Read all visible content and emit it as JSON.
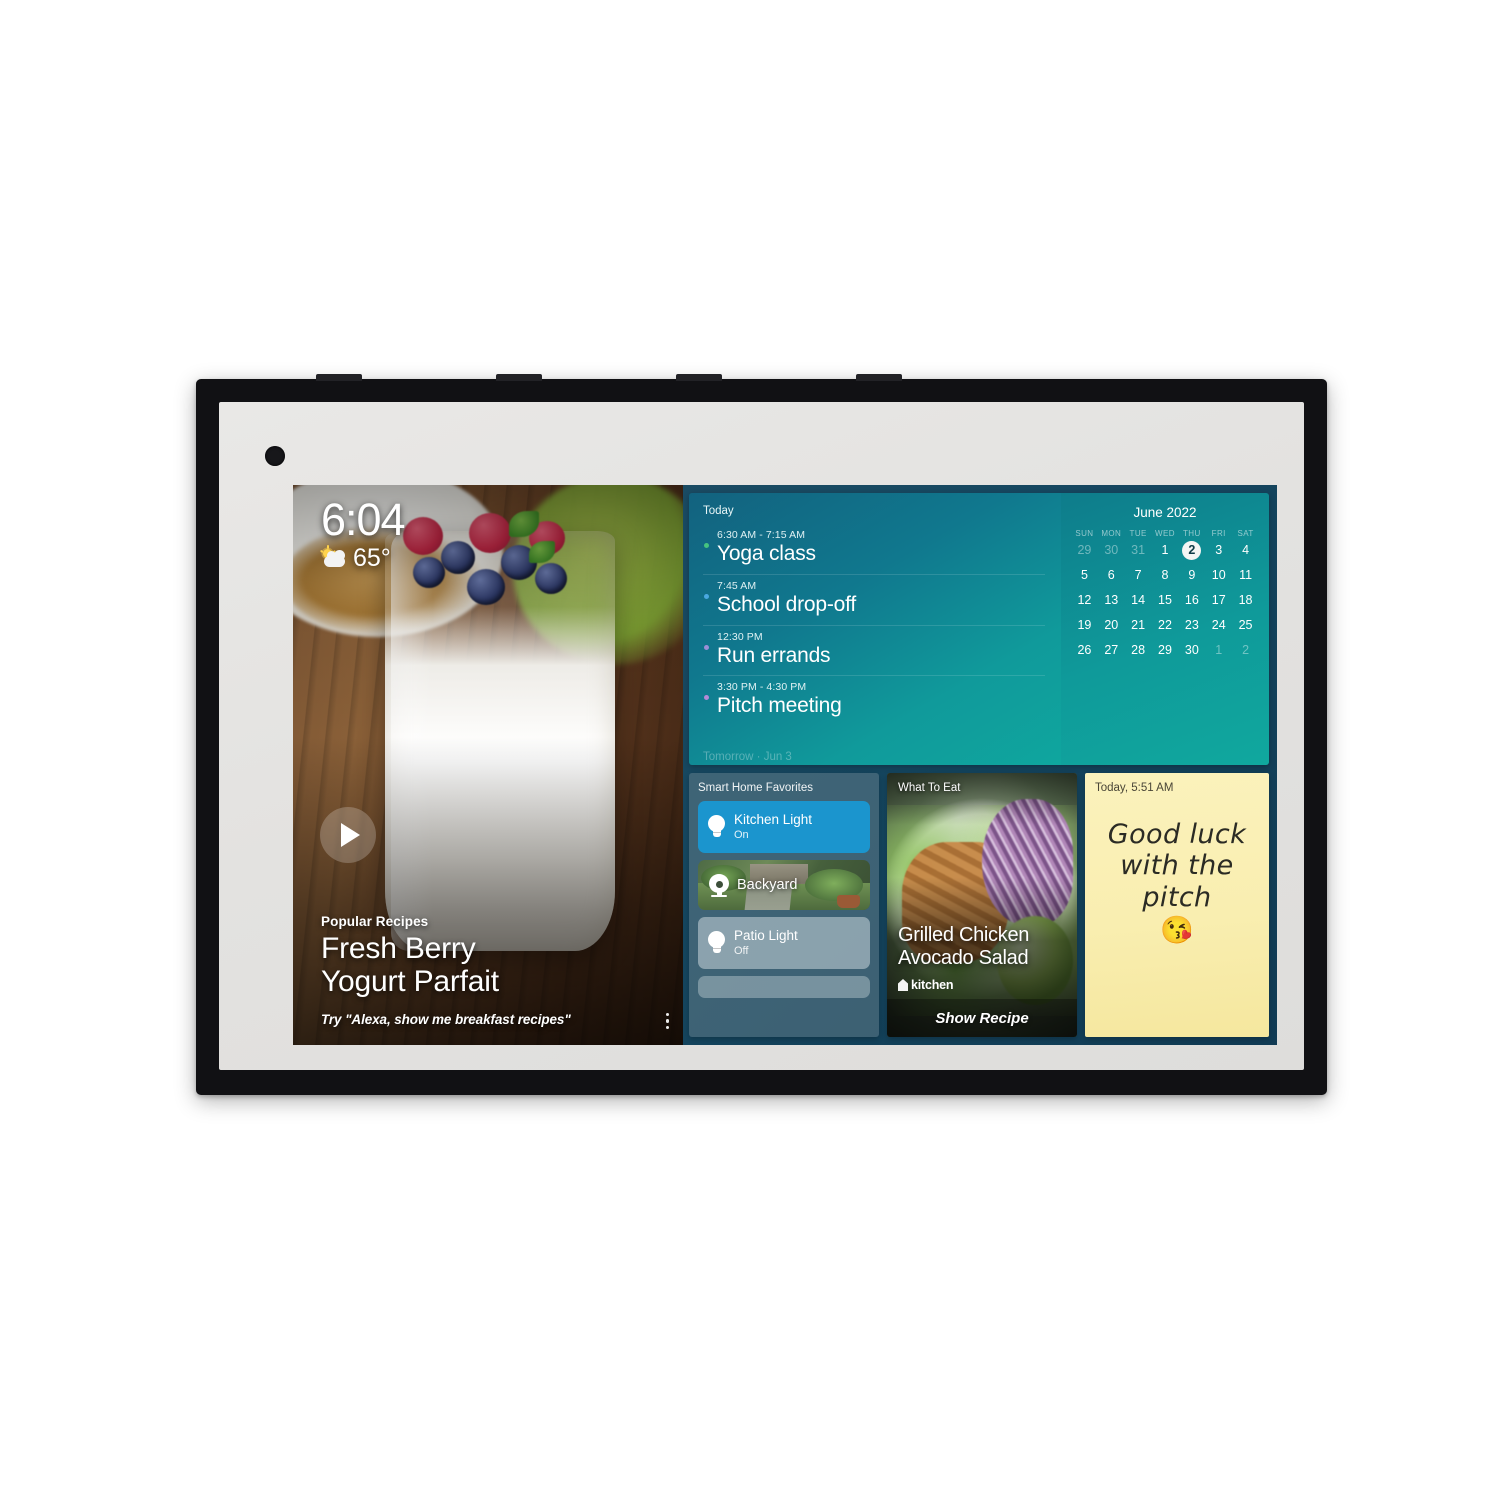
{
  "device": {
    "camera_icon": "camera-dot"
  },
  "clock": {
    "time": "6:04",
    "temperature": "65°",
    "weather_icon": "partly-cloudy-icon"
  },
  "hero": {
    "eyebrow": "Popular Recipes",
    "title_line1": "Fresh Berry",
    "title_line2": "Yogurt Parfait",
    "hint": "Try \"Alexa, show me breakfast recipes\"",
    "play_icon": "play-icon",
    "overflow_icon": "more-vertical-icon"
  },
  "calendar": {
    "agenda_label": "Today",
    "tomorrow_label": "Tomorrow · Jun 3",
    "events": [
      {
        "time": "6:30 AM - 7:15 AM",
        "title": "Yoga class",
        "dot_color": "#46c37f"
      },
      {
        "time": "7:45 AM",
        "title": "School drop-off",
        "dot_color": "#4aa8e0"
      },
      {
        "time": "12:30 PM",
        "title": "Run errands",
        "dot_color": "#9b8fd6"
      },
      {
        "time": "3:30 PM - 4:30 PM",
        "title": "Pitch meeting",
        "dot_color": "#b48ad6"
      }
    ],
    "month_title": "June 2022",
    "weekdays": [
      "SUN",
      "MON",
      "TUE",
      "WED",
      "THU",
      "FRI",
      "SAT"
    ],
    "days": [
      {
        "n": "29",
        "muted": true
      },
      {
        "n": "30",
        "muted": true
      },
      {
        "n": "31",
        "muted": true
      },
      {
        "n": "1"
      },
      {
        "n": "2",
        "today": true
      },
      {
        "n": "3"
      },
      {
        "n": "4"
      },
      {
        "n": "5"
      },
      {
        "n": "6"
      },
      {
        "n": "7"
      },
      {
        "n": "8"
      },
      {
        "n": "9"
      },
      {
        "n": "10"
      },
      {
        "n": "11"
      },
      {
        "n": "12"
      },
      {
        "n": "13"
      },
      {
        "n": "14"
      },
      {
        "n": "15"
      },
      {
        "n": "16"
      },
      {
        "n": "17"
      },
      {
        "n": "18"
      },
      {
        "n": "19"
      },
      {
        "n": "20"
      },
      {
        "n": "21"
      },
      {
        "n": "22"
      },
      {
        "n": "23"
      },
      {
        "n": "24"
      },
      {
        "n": "25"
      },
      {
        "n": "26"
      },
      {
        "n": "27"
      },
      {
        "n": "28"
      },
      {
        "n": "29"
      },
      {
        "n": "30"
      },
      {
        "n": "1",
        "muted": true
      },
      {
        "n": "2",
        "muted": true
      }
    ],
    "accent_today_bg": "#f3f6f4"
  },
  "smart_home": {
    "title": "Smart Home Favorites",
    "tiles": [
      {
        "name": "Kitchen Light",
        "state": "On",
        "type": "light",
        "icon": "lightbulb-icon",
        "on": true
      },
      {
        "name": "Backyard",
        "state": "",
        "type": "camera",
        "icon": "camera-icon",
        "on": false
      },
      {
        "name": "Patio Light",
        "state": "Off",
        "type": "light",
        "icon": "lightbulb-icon",
        "on": false
      }
    ],
    "on_color": "#1b95ce"
  },
  "what_to_eat": {
    "label": "What To Eat",
    "title_line1": "Grilled Chicken",
    "title_line2": "Avocado Salad",
    "brand": "kitchen",
    "cta": "Show Recipe"
  },
  "sticky_note": {
    "timestamp": "Today, 5:51 AM",
    "line1": "Good luck",
    "line2": "with the",
    "line3": "pitch",
    "emoji": "😘",
    "paper_color": "#fbf2bc"
  }
}
